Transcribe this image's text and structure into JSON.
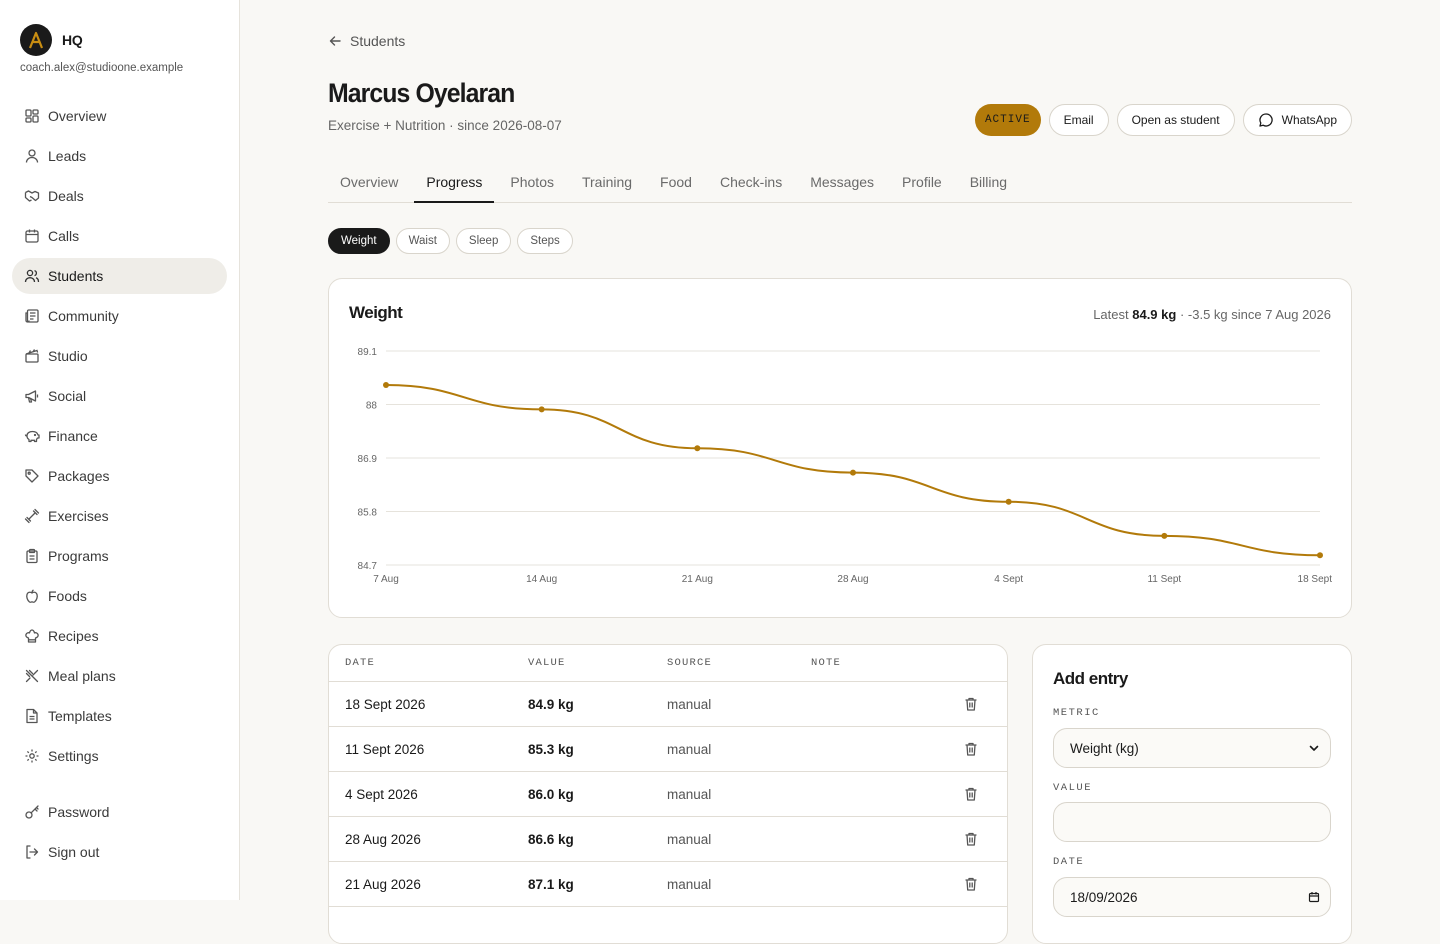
{
  "brand": {
    "name": "HQ",
    "logo_letter": "A",
    "email": "coach.alex@studioone.example"
  },
  "nav": [
    {
      "label": "Overview",
      "icon": "grid-icon"
    },
    {
      "label": "Leads",
      "icon": "user-icon"
    },
    {
      "label": "Deals",
      "icon": "handshake-icon"
    },
    {
      "label": "Calls",
      "icon": "calendar-icon"
    },
    {
      "label": "Students",
      "icon": "users-icon",
      "active": true
    },
    {
      "label": "Community",
      "icon": "newspaper-icon"
    },
    {
      "label": "Studio",
      "icon": "clapperboard-icon"
    },
    {
      "label": "Social",
      "icon": "megaphone-icon"
    },
    {
      "label": "Finance",
      "icon": "piggy-bank-icon"
    },
    {
      "label": "Packages",
      "icon": "tag-icon"
    },
    {
      "label": "Exercises",
      "icon": "dumbbell-icon"
    },
    {
      "label": "Programs",
      "icon": "clipboard-icon"
    },
    {
      "label": "Foods",
      "icon": "apple-icon"
    },
    {
      "label": "Recipes",
      "icon": "chef-hat-icon"
    },
    {
      "label": "Meal plans",
      "icon": "utensils-icon"
    },
    {
      "label": "Templates",
      "icon": "file-icon"
    },
    {
      "label": "Settings",
      "icon": "gear-icon"
    }
  ],
  "nav_bottom": [
    {
      "label": "Password",
      "icon": "key-icon"
    },
    {
      "label": "Sign out",
      "icon": "sign-out-icon"
    }
  ],
  "back_label": "Students",
  "student": {
    "name": "Marcus Oyelaran",
    "subtitle": "Exercise + Nutrition · since 2026-08-07"
  },
  "actions": {
    "status": "ACTIVE",
    "email": "Email",
    "open_as_student": "Open as student",
    "whatsapp": "WhatsApp"
  },
  "tabs": [
    "Overview",
    "Progress",
    "Photos",
    "Training",
    "Food",
    "Check-ins",
    "Messages",
    "Profile",
    "Billing"
  ],
  "active_tab": "Progress",
  "metrics": [
    "Weight",
    "Waist",
    "Sleep",
    "Steps"
  ],
  "active_metric": "Weight",
  "summary": {
    "prefix": "Latest",
    "latest": "84.9 kg",
    "change": "· -3.5 kg since 7 Aug 2026"
  },
  "colors": {
    "accent": "#b27a0a",
    "ink": "#1a1a1a",
    "border": "#e1ddd5"
  },
  "chart_data": {
    "type": "line",
    "title": "Weight",
    "x": [
      "7 Aug",
      "14 Aug",
      "21 Aug",
      "28 Aug",
      "4 Sept",
      "11 Sept",
      "18 Sept"
    ],
    "values": [
      88.4,
      87.9,
      87.1,
      86.6,
      86.0,
      85.3,
      84.9
    ],
    "yticks": [
      "89.1",
      "88",
      "86.9",
      "85.8",
      "84.7"
    ],
    "ylim": [
      84.7,
      89.1
    ],
    "grid": true,
    "color": "#b27a0a"
  },
  "table": {
    "headers": {
      "date": "DATE",
      "value": "VALUE",
      "source": "SOURCE",
      "note": "NOTE"
    },
    "rows": [
      {
        "date": "18 Sept 2026",
        "value": "84.9 kg",
        "source": "manual",
        "note": ""
      },
      {
        "date": "11 Sept 2026",
        "value": "85.3 kg",
        "source": "manual",
        "note": ""
      },
      {
        "date": "4 Sept 2026",
        "value": "86.0 kg",
        "source": "manual",
        "note": ""
      },
      {
        "date": "28 Aug 2026",
        "value": "86.6 kg",
        "source": "manual",
        "note": ""
      },
      {
        "date": "21 Aug 2026",
        "value": "87.1 kg",
        "source": "manual",
        "note": ""
      }
    ]
  },
  "entry": {
    "title": "Add entry",
    "metric_label": "METRIC",
    "metric_value": "Weight (kg)",
    "value_label": "VALUE",
    "value_value": "",
    "date_label": "DATE",
    "date_value": "18/09/2026"
  }
}
